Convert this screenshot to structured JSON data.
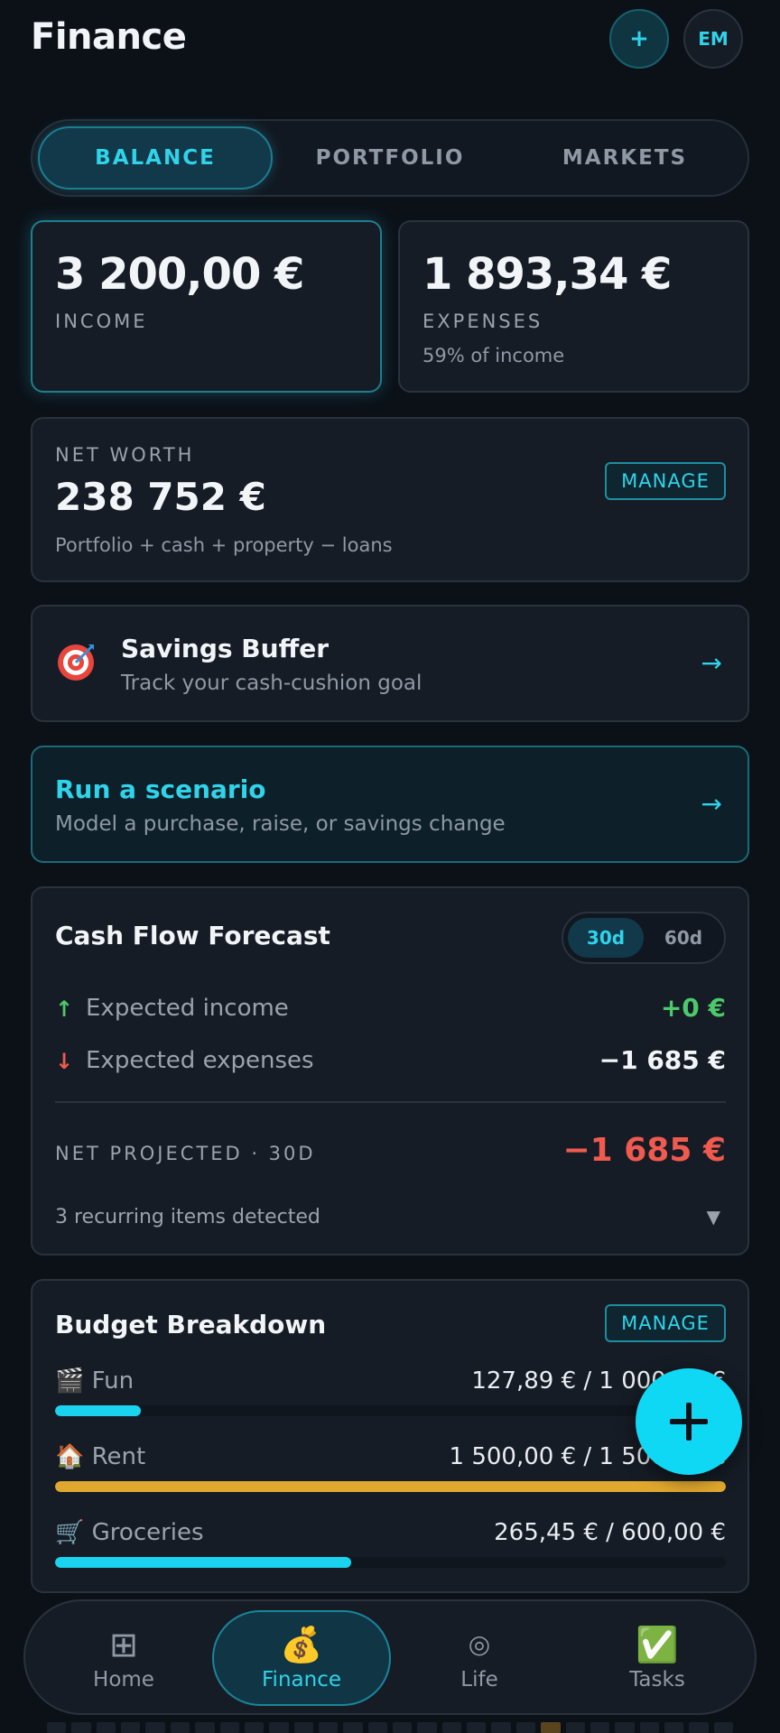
{
  "header": {
    "title": "Finance",
    "add_label": "+",
    "avatar_initials": "EM"
  },
  "tabs": [
    {
      "label": "BALANCE",
      "active": true
    },
    {
      "label": "PORTFOLIO",
      "active": false
    },
    {
      "label": "MARKETS",
      "active": false
    }
  ],
  "income": {
    "value": "3 200,00 €",
    "label": "INCOME"
  },
  "expenses": {
    "value": "1 893,34 €",
    "label": "EXPENSES",
    "note": "59% of income"
  },
  "net_worth": {
    "label": "NET WORTH",
    "value": "238 752 €",
    "note": "Portfolio + cash + property − loans",
    "manage_label": "MANAGE"
  },
  "savings": {
    "title": "Savings Buffer",
    "subtitle": "Track your cash-cushion goal",
    "icon": "target-icon",
    "arrow": "→"
  },
  "scenario": {
    "title": "Run a scenario",
    "subtitle": "Model a purchase, raise, or savings change",
    "arrow": "→"
  },
  "forecast": {
    "title": "Cash Flow Forecast",
    "ranges": [
      "30d",
      "60d"
    ],
    "active_range": "30d",
    "income_icon": "↑",
    "income_label": "Expected income",
    "income_value": "+0 €",
    "expense_icon": "↓",
    "expense_label": "Expected expenses",
    "expense_value": "−1 685 €",
    "net_label": "NET PROJECTED · 30D",
    "net_value": "−1 685 €",
    "recurring_note": "3 recurring items detected",
    "chevron": "▼"
  },
  "budget": {
    "title": "Budget Breakdown",
    "manage_label": "MANAGE",
    "items": [
      {
        "icon": "🎬",
        "name": "Fun",
        "amount": "127,89 € / 1 000,00 €",
        "fraction": 0.128,
        "color": "#19d3ef"
      },
      {
        "icon": "🏠",
        "name": "Rent",
        "amount": "1 500,00 € / 1 500,00 €",
        "fraction": 1.0,
        "color": "#e0a82e"
      },
      {
        "icon": "🛒",
        "name": "Groceries",
        "amount": "265,45 € / 600,00 €",
        "fraction": 0.442,
        "color": "#19d3ef"
      }
    ]
  },
  "fab_label": "+",
  "nav": [
    {
      "icon": "⊞",
      "label": "Home",
      "active": false
    },
    {
      "icon": "💰",
      "label": "Finance",
      "active": true
    },
    {
      "icon": "◎",
      "label": "Life",
      "active": false
    },
    {
      "icon": "✅",
      "label": "Tasks",
      "active": false
    }
  ],
  "colors": {
    "accent": "#2fd3ea",
    "positive": "#4cc96a",
    "negative": "#f05a4f",
    "background": "#0c1118"
  }
}
